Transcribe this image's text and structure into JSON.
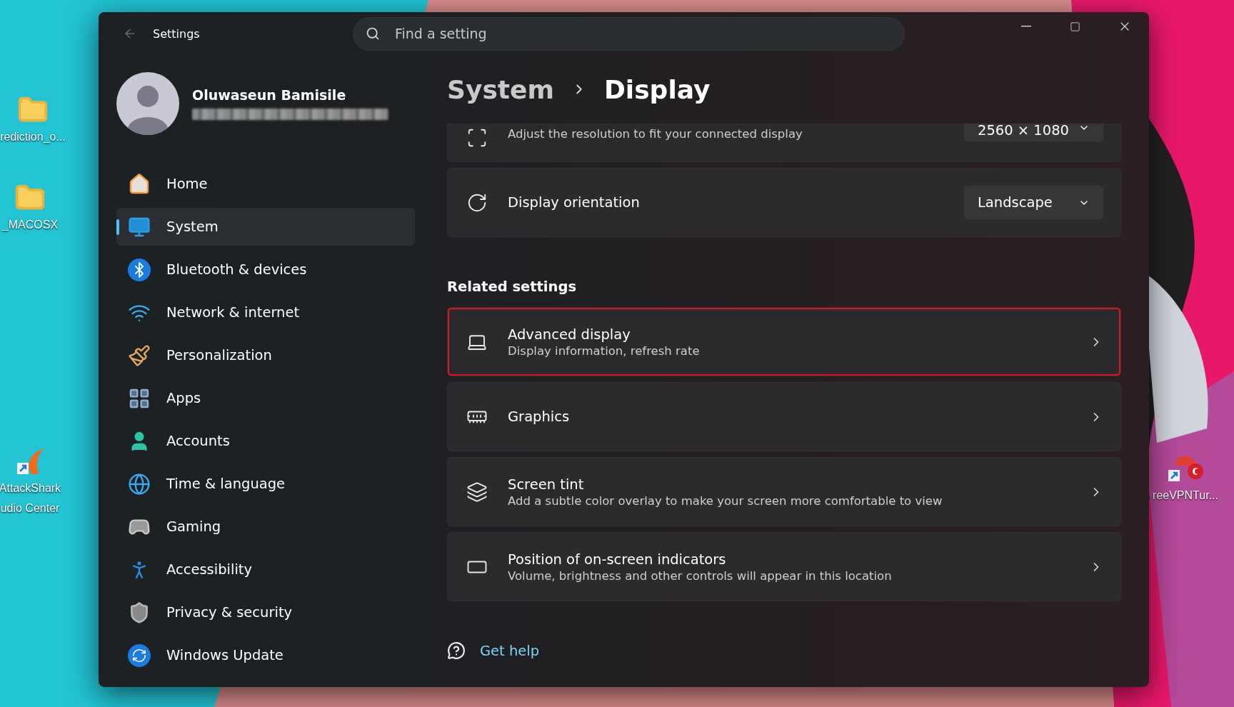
{
  "desktop": {
    "icons": [
      {
        "kind": "folder",
        "lines": [
          "rediction_o..."
        ]
      },
      {
        "kind": "folder",
        "lines": [
          "_MACOSX"
        ]
      },
      {
        "kind": "app",
        "lines": [
          "AttackShark",
          "udio Center"
        ]
      },
      {
        "kind": "vpn",
        "lines": [
          "reeVPNTur..."
        ]
      }
    ]
  },
  "window": {
    "title": "Settings",
    "search": {
      "placeholder": "Find a setting"
    },
    "profile": {
      "name": "Oluwaseun Bamisile"
    },
    "nav": [
      {
        "label": "Home",
        "kind": "home",
        "selected": false
      },
      {
        "label": "System",
        "kind": "system",
        "selected": true
      },
      {
        "label": "Bluetooth & devices",
        "kind": "bluetooth",
        "selected": false
      },
      {
        "label": "Network & internet",
        "kind": "network",
        "selected": false
      },
      {
        "label": "Personalization",
        "kind": "brush",
        "selected": false
      },
      {
        "label": "Apps",
        "kind": "apps",
        "selected": false
      },
      {
        "label": "Accounts",
        "kind": "accounts",
        "selected": false
      },
      {
        "label": "Time & language",
        "kind": "time",
        "selected": false
      },
      {
        "label": "Gaming",
        "kind": "gaming",
        "selected": false
      },
      {
        "label": "Accessibility",
        "kind": "accessibility",
        "selected": false
      },
      {
        "label": "Privacy & security",
        "kind": "privacy",
        "selected": false
      },
      {
        "label": "Windows Update",
        "kind": "update",
        "selected": false
      }
    ],
    "breadcrumb": [
      "System",
      "Display"
    ],
    "settings": [
      {
        "kind": "resolution",
        "description": "Adjust the resolution to fit your connected display",
        "value": "2560 × 1080"
      },
      {
        "kind": "orientation",
        "title": "Display orientation",
        "value": "Landscape"
      }
    ],
    "related": {
      "heading": "Related settings",
      "items": [
        {
          "kind": "laptop",
          "title": "Advanced display",
          "description": "Display information, refresh rate",
          "highlighted": true
        },
        {
          "kind": "graphics",
          "title": "Graphics",
          "highlighted": false
        },
        {
          "kind": "layers",
          "title": "Screen tint",
          "description": "Add a subtle color overlay to make your screen more comfortable to view",
          "highlighted": false
        },
        {
          "kind": "position",
          "title": "Position of on-screen indicators",
          "description": "Volume, brightness and other controls will appear in this location",
          "highlighted": false
        }
      ]
    },
    "help": {
      "label": "Get help"
    }
  }
}
